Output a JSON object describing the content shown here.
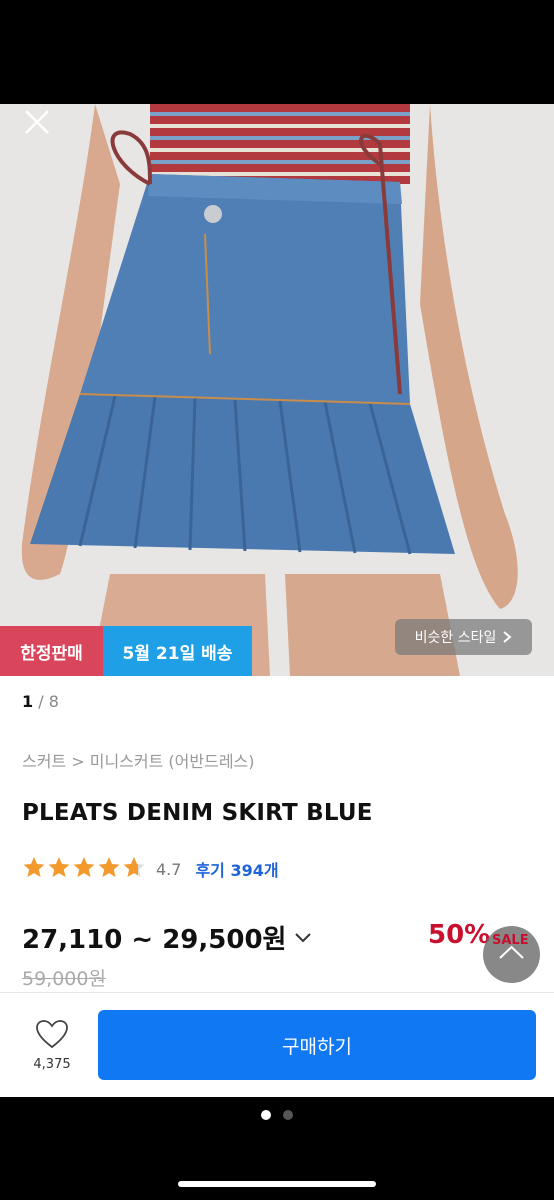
{
  "gallery": {
    "current": "1",
    "total": "/ 8",
    "badge_limited": "한정판매",
    "badge_delivery": "5월 21일 배송",
    "similar_style": "비슷한 스타일",
    "close_icon": "close-icon"
  },
  "product": {
    "breadcrumb": "스커트 > 미니스커트 (어반드레스)",
    "title": "PLEATS DENIM SKIRT BLUE",
    "rating_value": "4.7",
    "rating_stars": 4.7,
    "review_link": "후기 394개",
    "price_range": "27,110 ~ 29,500원",
    "discount": "50%",
    "original_price": "59,000원",
    "sale_label": "SALE"
  },
  "bottom": {
    "like_count": "4,375",
    "buy_label": "구매하기"
  },
  "pager": {
    "active": 0,
    "count": 2
  },
  "colors": {
    "accent_blue": "#0f78f2",
    "badge_red": "#d9465b",
    "badge_blue": "#1fa0e6",
    "discount_red": "#c8102e",
    "review_blue": "#1f63d8",
    "star_orange": "#f39a2e"
  }
}
